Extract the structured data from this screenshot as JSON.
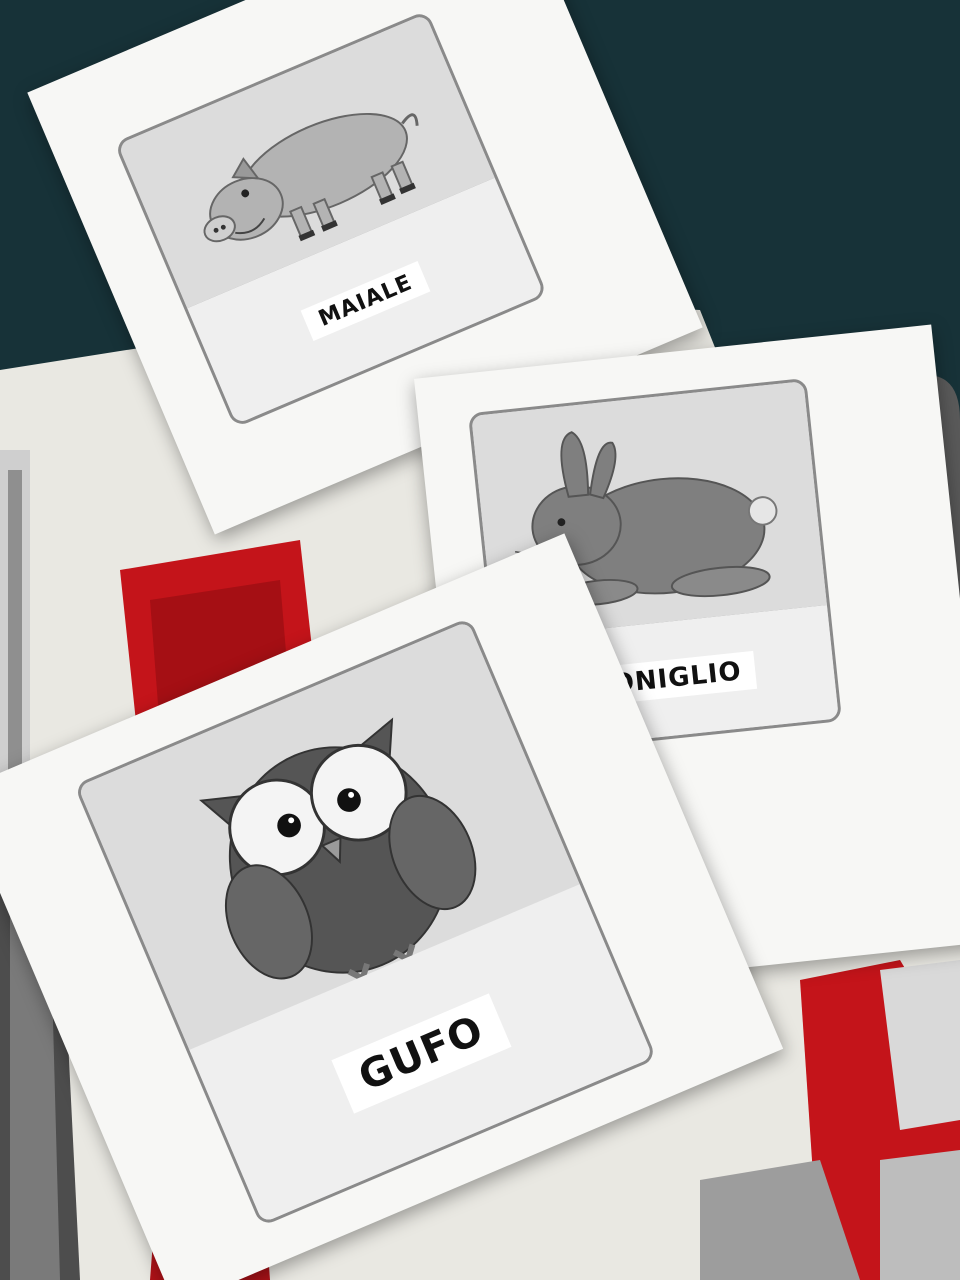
{
  "photo": {
    "description_colors": {
      "blanket": "#1c3a40",
      "fabric": "#ecebe5",
      "red_cloth": "#c4141a"
    }
  },
  "cards": [
    {
      "animal": "pig",
      "label": "MAIALE"
    },
    {
      "animal": "rabbit",
      "label": "CONIGLIO"
    },
    {
      "animal": "owl",
      "label": "GUFO"
    }
  ]
}
